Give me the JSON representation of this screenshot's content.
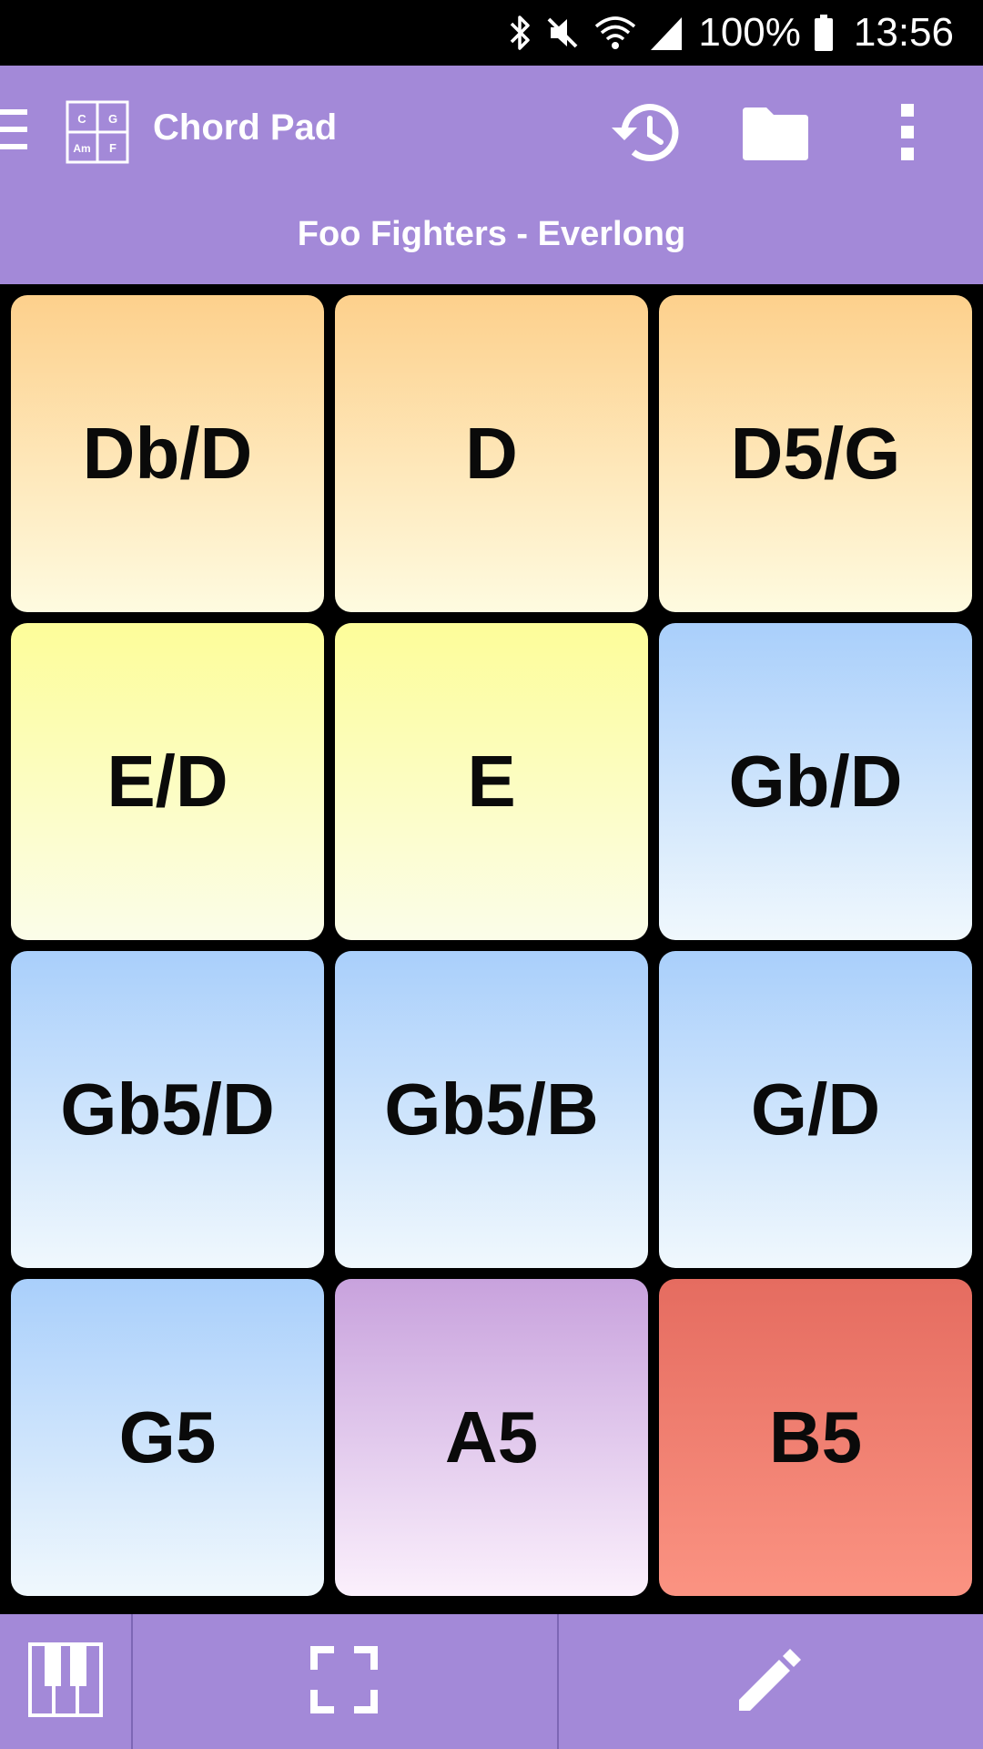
{
  "status_bar": {
    "battery_percent": "100%",
    "time": "13:56",
    "icons": [
      "bluetooth-icon",
      "mute-icon",
      "wifi-icon",
      "signal-icon",
      "battery-icon"
    ]
  },
  "app_bar": {
    "title": "Chord Pad",
    "song_title": "Foo Fighters - Everlong",
    "background_color": "#a389d8",
    "logo_letters": [
      "C",
      "G",
      "Am",
      "F"
    ],
    "icons": [
      "menu-icon",
      "history-icon",
      "folder-icon",
      "more-vert-icon"
    ]
  },
  "pads": [
    {
      "label": "Db/D",
      "color": "orange"
    },
    {
      "label": "D",
      "color": "orange"
    },
    {
      "label": "D5/G",
      "color": "orange"
    },
    {
      "label": "E/D",
      "color": "yellow"
    },
    {
      "label": "E",
      "color": "yellow"
    },
    {
      "label": "Gb/D",
      "color": "blue"
    },
    {
      "label": "Gb5/D",
      "color": "blue"
    },
    {
      "label": "Gb5/B",
      "color": "blue"
    },
    {
      "label": "G/D",
      "color": "blue"
    },
    {
      "label": "G5",
      "color": "blue"
    },
    {
      "label": "A5",
      "color": "purple"
    },
    {
      "label": "B5",
      "color": "red"
    }
  ],
  "bottom_bar": {
    "icons": [
      "piano-icon",
      "fullscreen-icon",
      "edit-icon"
    ]
  }
}
